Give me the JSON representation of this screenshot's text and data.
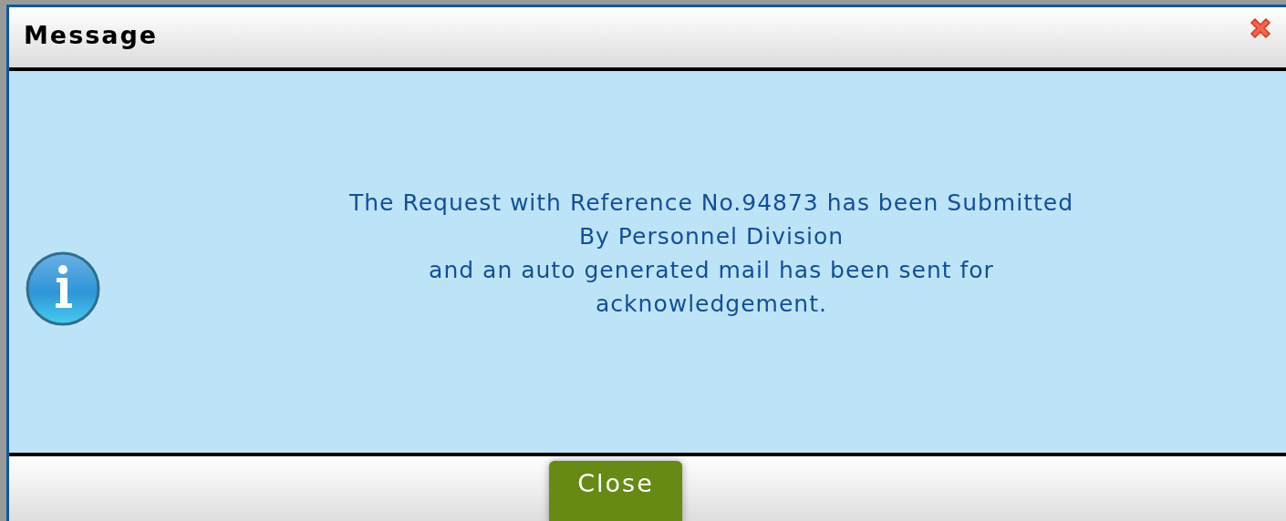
{
  "dialog": {
    "title": "Message",
    "message": "The Request with Reference No.94873 has been Submitted\nBy Personnel Division\nand an auto generated mail has been sent for\nacknowledgement.",
    "buttons": [
      "Close"
    ]
  }
}
